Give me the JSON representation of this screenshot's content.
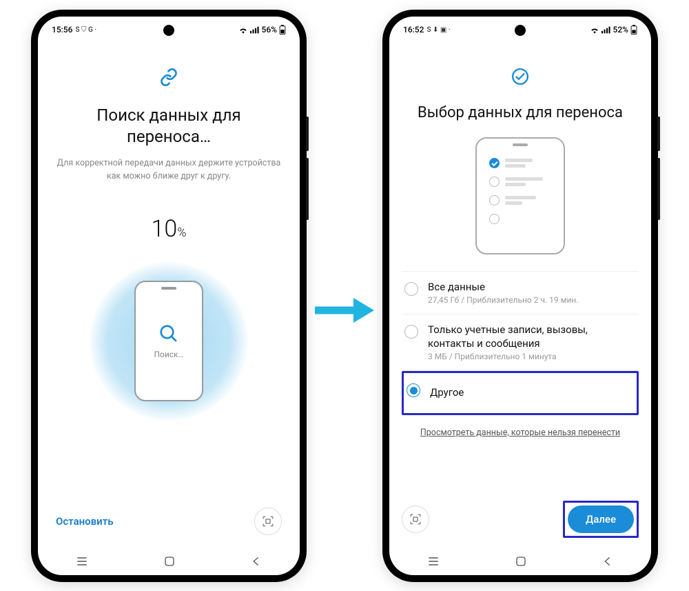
{
  "phone_left": {
    "status": {
      "time": "15:56",
      "icons_left": "S ⛉ G ·",
      "battery": "56%"
    },
    "title": "Поиск данных для переноса…",
    "subtitle": "Для корректной передачи данных держите устройства как можно ближе друг к другу.",
    "progress_value": "10",
    "progress_unit": "%",
    "search_label": "Поиск…",
    "stop_label": "Остановить"
  },
  "phone_right": {
    "status": {
      "time": "16:52",
      "icons_left": "S ⬇ ▣ ·",
      "battery": "52%"
    },
    "title": "Выбор данных для переноса",
    "options": [
      {
        "title": "Все данные",
        "sub": "27,45 Гб / Приблизительно 2 ч. 19 мин.",
        "selected": false
      },
      {
        "title": "Только учетные записи, вызовы, контакты и сообщения",
        "sub": "3 МБ / Приблизительно 1 минута",
        "selected": false
      },
      {
        "title": "Другое",
        "sub": "",
        "selected": true,
        "highlight": true
      }
    ],
    "link": "Просмотреть данные, которые нельзя перенести",
    "next_label": "Далее"
  }
}
